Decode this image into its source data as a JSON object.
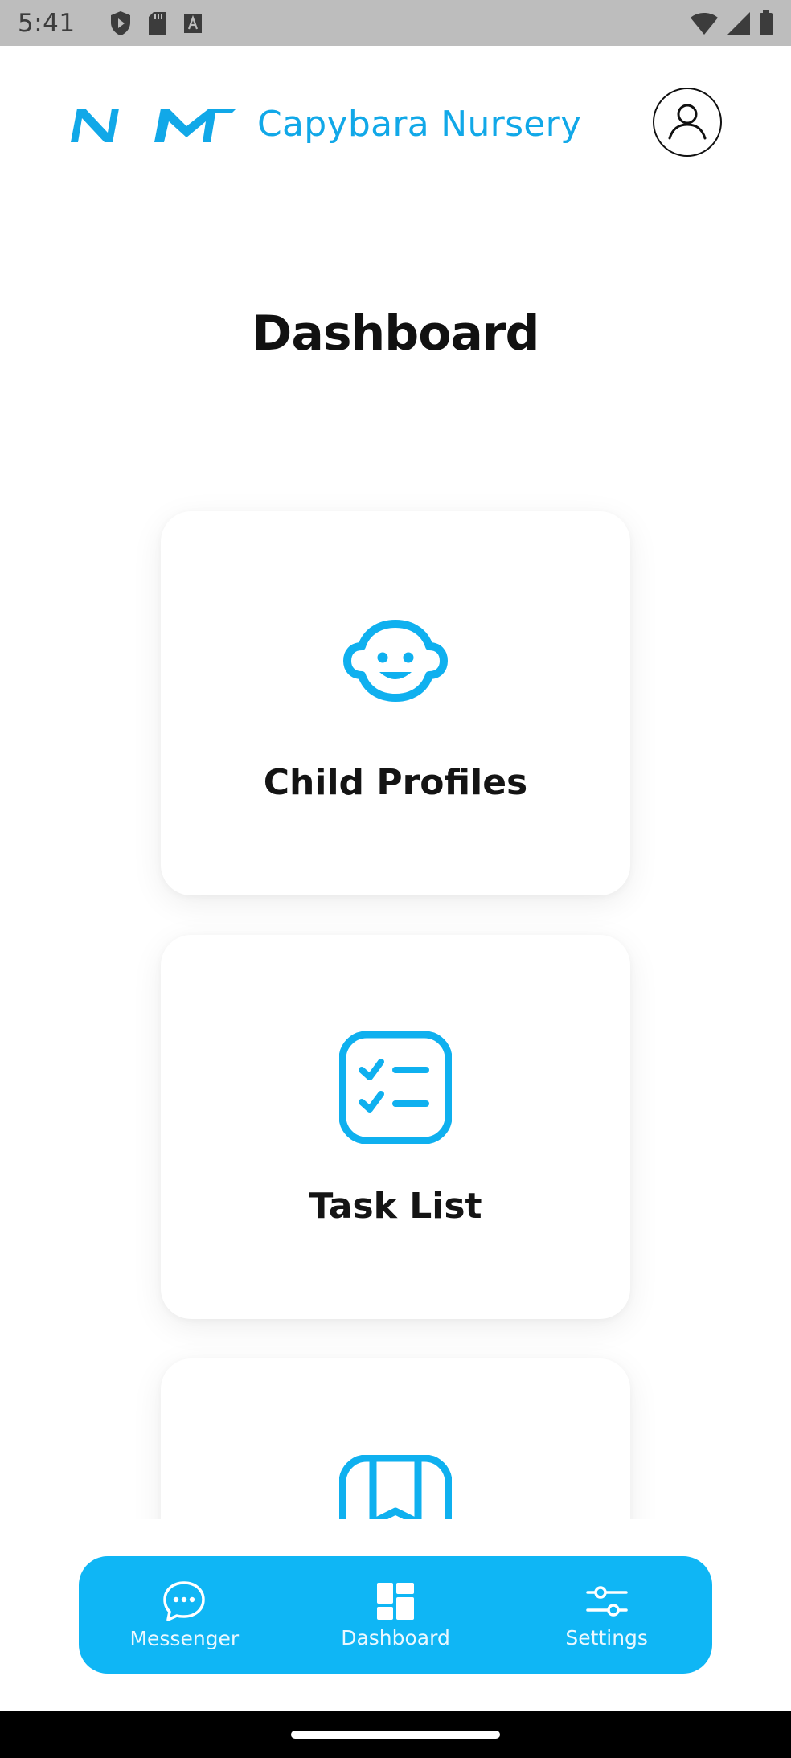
{
  "status_bar": {
    "time": "5:41",
    "icons_left": [
      "shield-play-icon",
      "sd-card-icon",
      "a-box-icon"
    ],
    "icons_right": [
      "wifi-icon",
      "cellular-signal-icon",
      "battery-icon"
    ]
  },
  "header": {
    "app_name": "Capybara Nursery",
    "logo": "NM",
    "accent_color": "#11a8e8"
  },
  "main": {
    "title": "Dashboard",
    "cards": [
      {
        "label": "Child Profiles",
        "icon": "baby-face-icon"
      },
      {
        "label": "Task List",
        "icon": "checklist-icon"
      },
      {
        "label": "",
        "icon": "book-icon"
      }
    ]
  },
  "bottom_nav": {
    "background": "#0fb6f5",
    "items": [
      {
        "label": "Messenger",
        "icon": "chat-bubble-icon"
      },
      {
        "label": "Dashboard",
        "icon": "dashboard-grid-icon"
      },
      {
        "label": "Settings",
        "icon": "sliders-icon"
      }
    ]
  }
}
